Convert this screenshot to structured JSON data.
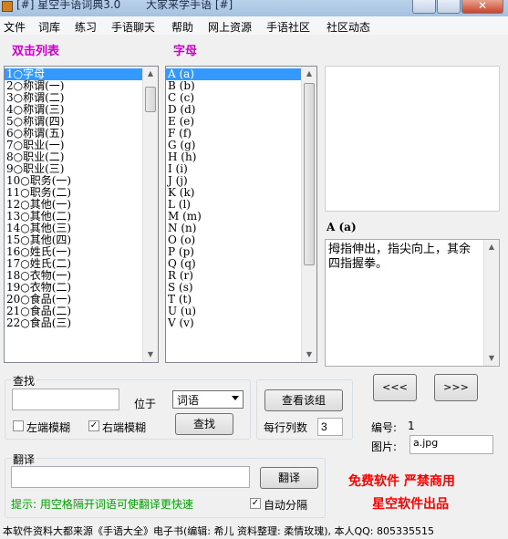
{
  "titlebar": {
    "title": "[#] 星空手语词典3.0",
    "subtitle": "大家来学手语 [#]",
    "close_glyph": "✕"
  },
  "menu": [
    "文件",
    "词库",
    "练习",
    "手语聊天",
    "帮助",
    "网上资源",
    "手语社区",
    "社区动态"
  ],
  "labels": {
    "double_click_list": "双击列表",
    "letters": "字母"
  },
  "categories": [
    "1○字母",
    "2○称谓(一)",
    "3○称谓(二)",
    "4○称谓(三)",
    "5○称谓(四)",
    "6○称谓(五)",
    "7○职业(一)",
    "8○职业(二)",
    "9○职业(三)",
    "10○职务(一)",
    "11○职务(二)",
    "12○其他(一)",
    "13○其他(二)",
    "14○其他(三)",
    "15○其他(四)",
    "16○姓氏(一)",
    "17○姓氏(二)",
    "18○衣物(一)",
    "19○衣物(二)",
    "20○食品(一)",
    "21○食品(二)",
    "22○食品(三)"
  ],
  "letters": [
    "A (a)",
    "B (b)",
    "C (c)",
    "D (d)",
    "E (e)",
    "F (f)",
    "G (g)",
    "H (h)",
    "I (i)",
    "J (j)",
    "K (k)",
    "L (l)",
    "M (m)",
    "N (n)",
    "O (o)",
    "P (p)",
    "Q (q)",
    "R (r)",
    "S (s)",
    "T (t)",
    "U (u)",
    "V (v)"
  ],
  "detail": {
    "word": "A (a)",
    "description": "拇指伸出，指尖向上，其余四指握拳。"
  },
  "search": {
    "group_title": "查找",
    "input_value": "",
    "position_label": "位于",
    "position_value": "词语",
    "left_fuzzy": "左端模糊",
    "right_fuzzy": "右端模糊",
    "find_button": "查找"
  },
  "view": {
    "view_group_button": "查看该组",
    "cols_label": "每行列数",
    "cols_value": "3"
  },
  "nav": {
    "prev": "<<<",
    "next": ">>>"
  },
  "info": {
    "number_label": "编号: ",
    "number_value": "1",
    "image_label": "图片: ",
    "image_value": "a.jpg"
  },
  "translate": {
    "group_title": "翻译",
    "input_value": "",
    "button": "翻译",
    "hint": "提示: 用空格隔开词语可使翻译更快速",
    "auto_split": "自动分隔"
  },
  "promo": {
    "line1": "免费软件  严禁商用",
    "line2": "星空软件出品"
  },
  "footer": "本软件资料大都来源《手语大全》电子书(编辑: 希儿 资料整理: 柔情玫瑰), 本人QQ: 805335515",
  "colors": {
    "selection": "#3399ff",
    "label_magenta": "#cc00cc",
    "promo_red": "#ff0000",
    "hint_green": "#00a000"
  }
}
